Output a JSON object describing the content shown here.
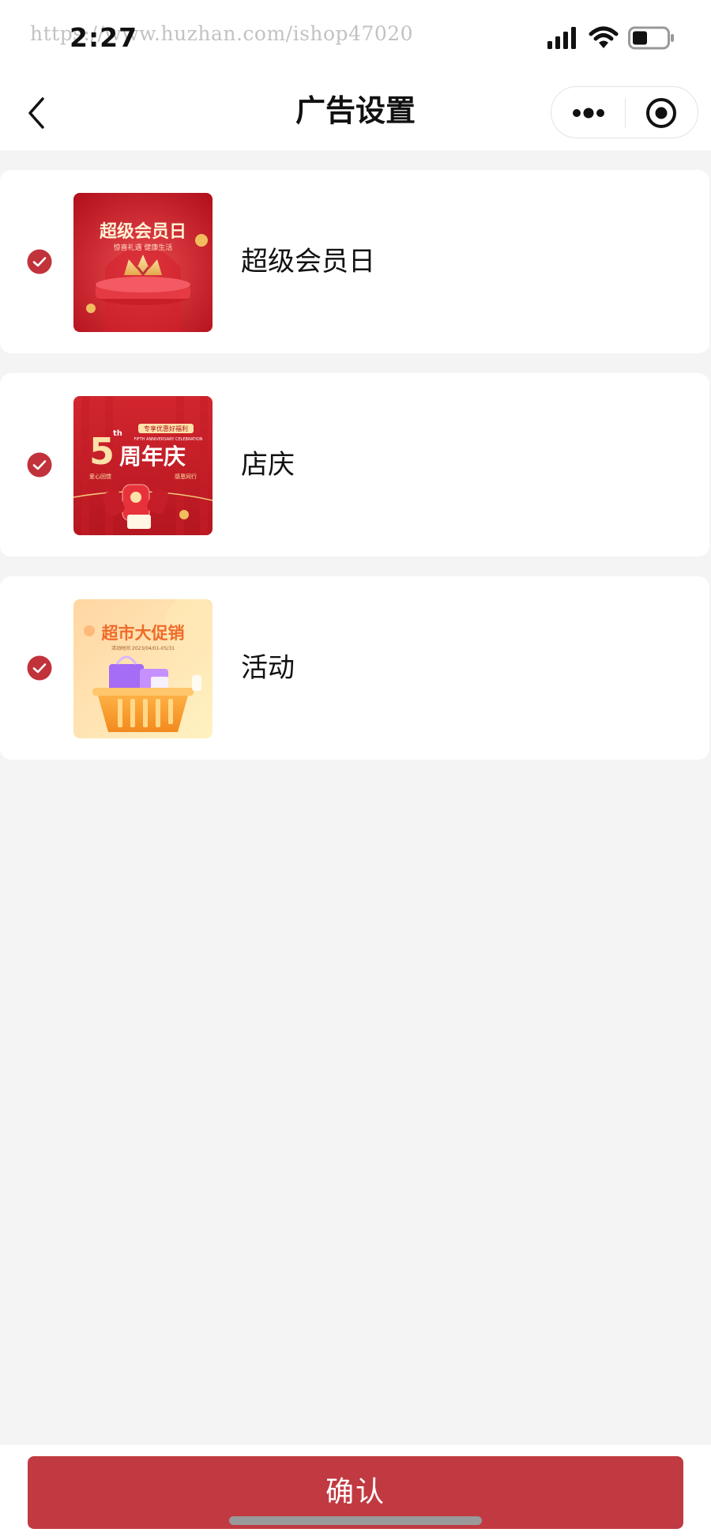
{
  "status_bar": {
    "time": "2:27",
    "watermark": "https://www.huzhan.com/ishop47020",
    "icons": [
      "signal-icon",
      "wifi-icon",
      "battery-icon"
    ]
  },
  "nav": {
    "title": "广告设置",
    "back_icon": "back-icon",
    "more_icon": "more-icon",
    "close_icon": "close-icon"
  },
  "items": [
    {
      "label": "超级会员日",
      "checked": true,
      "thumb_title": "超级会员日",
      "thumb_subtitle": "惊喜礼遇 健康生活"
    },
    {
      "label": "店庆",
      "checked": true,
      "thumb_big": "5",
      "thumb_sup": "th",
      "thumb_title": "周年庆",
      "thumb_tag": "专享优惠好福利",
      "thumb_en": "FIFTH ANNIVERSARY CELEBRATION",
      "thumb_left": "爱心回馈",
      "thumb_right": "感恩同行"
    },
    {
      "label": "活动",
      "checked": true,
      "thumb_title": "超市大促销",
      "thumb_subtitle": "活动时间 2023/04/01-05/31"
    }
  ],
  "confirm_label": "确认",
  "colors": {
    "accent": "#c13a41",
    "check": "#c1323b",
    "background": "#f4f4f4"
  }
}
